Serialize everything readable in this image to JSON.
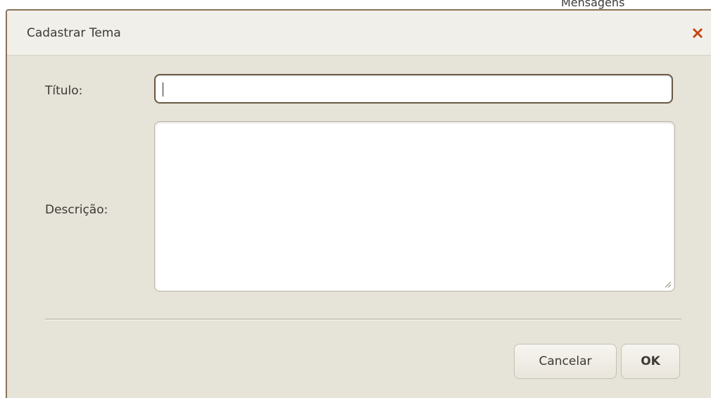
{
  "background": {
    "partial_text": "Mensagens"
  },
  "dialog": {
    "title": "Cadastrar Tema",
    "close_icon": "close-x-icon",
    "close_color": "#c0440f"
  },
  "form": {
    "titulo_label": "Título:",
    "titulo_value": "",
    "descricao_label": "Descrição:",
    "descricao_value": ""
  },
  "buttons": {
    "cancel_label": "Cancelar",
    "ok_label": "OK"
  }
}
